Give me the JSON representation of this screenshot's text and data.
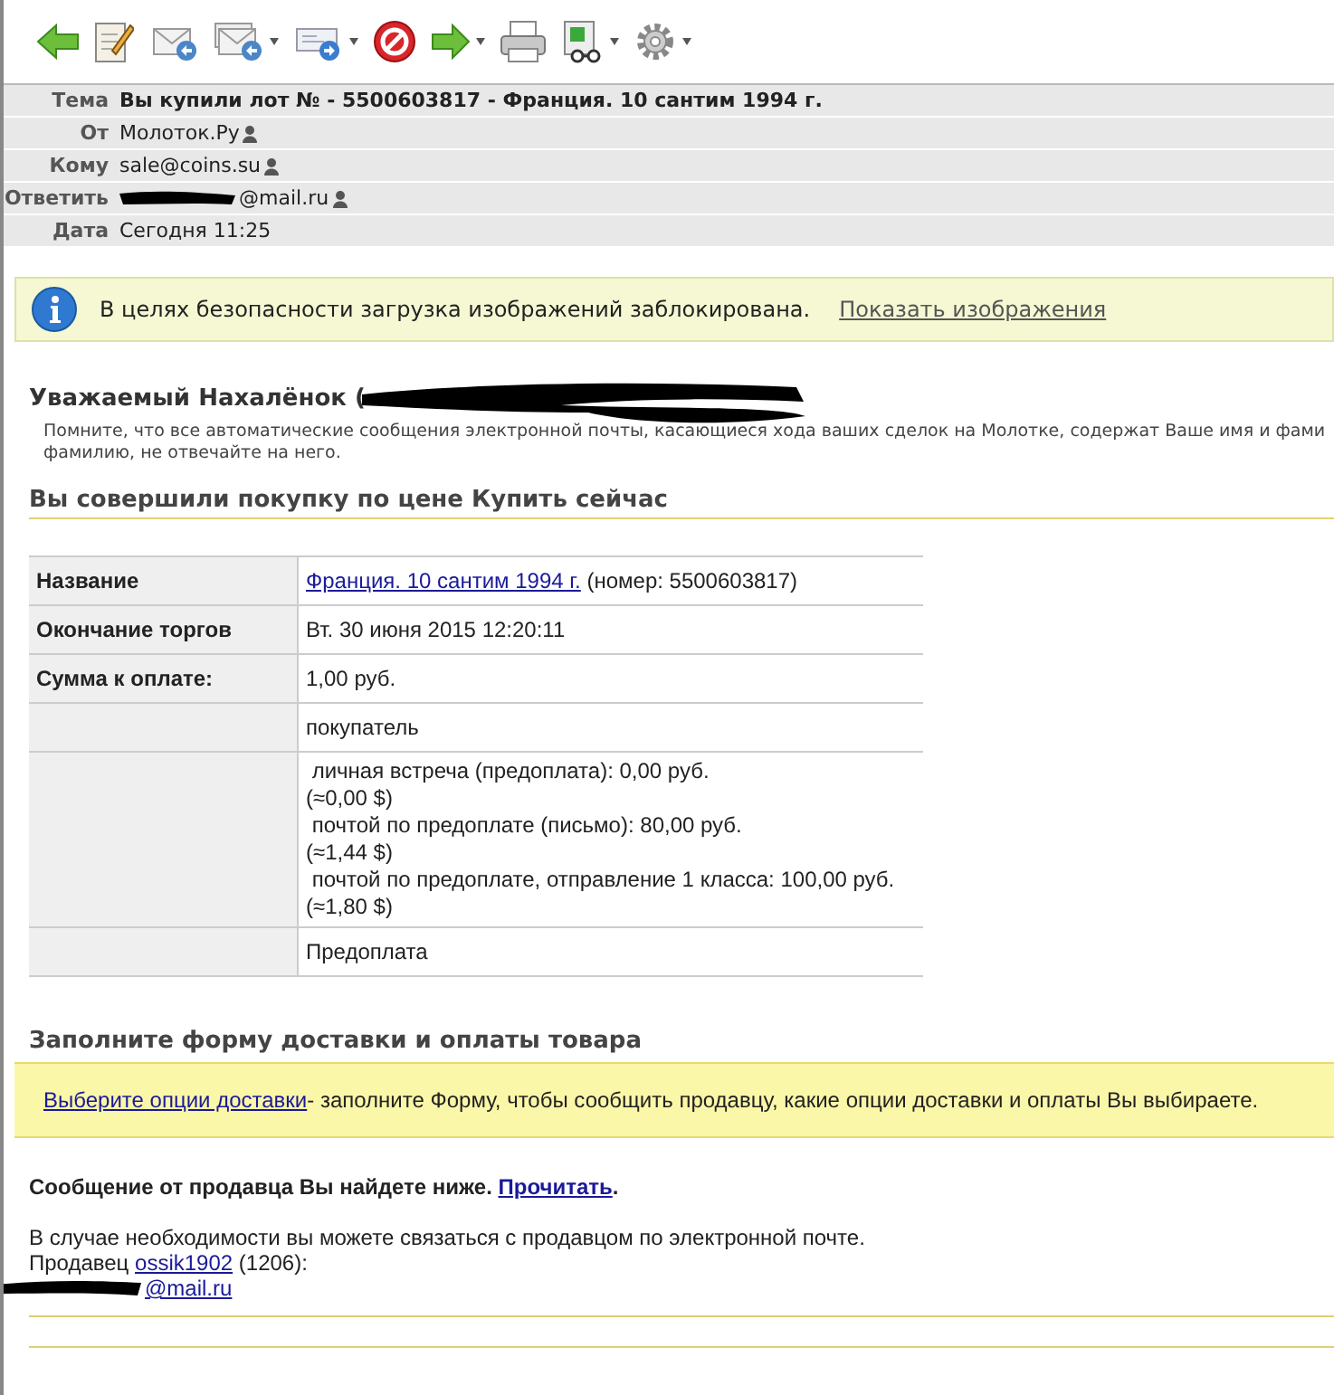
{
  "toolbar": [
    {
      "kind": "back",
      "menu": false
    },
    {
      "kind": "compose",
      "menu": false
    },
    {
      "kind": "reply",
      "menu": false
    },
    {
      "kind": "reply_all",
      "menu": true
    },
    {
      "kind": "forward",
      "menu": true
    },
    {
      "kind": "block",
      "menu": false
    },
    {
      "kind": "next",
      "menu": true
    },
    {
      "kind": "print",
      "menu": false
    },
    {
      "kind": "view",
      "menu": true
    },
    {
      "kind": "settings",
      "menu": true
    }
  ],
  "headers": [
    {
      "label": "Тема",
      "value": "Вы купили лот № - 5500603817 - Франция. 10 сантим 1994 г.",
      "bold": true,
      "contact": false,
      "redacted": false
    },
    {
      "label": "От",
      "value": "Молоток.Ру",
      "bold": false,
      "contact": true,
      "redacted": false
    },
    {
      "label": "Кому",
      "value": "sale@coins.su",
      "bold": false,
      "contact": true,
      "redacted": false
    },
    {
      "label": "Ответить",
      "value": "@mail.ru",
      "bold": false,
      "contact": true,
      "redacted": true
    },
    {
      "label": "Дата",
      "value": "Сегодня 11:25",
      "bold": false,
      "contact": false,
      "redacted": false
    }
  ],
  "security_bar": {
    "message": "В целях безопасности загрузка изображений заблокирована.",
    "link": "Показать изображения"
  },
  "greeting": "Уважаемый Нахалёнок (",
  "notice": [
    "Помните, что все автоматические сообщения электронной почты, касающиеся хода ваших сделок на Молотке, содержат Ваше имя и фами",
    "фамилию, не отвечайте на него."
  ],
  "purchase_heading": "Вы совершили покупку по цене Купить сейчас",
  "table": {
    "rows": [
      {
        "label": "Название",
        "link": "Франция. 10 сантим 1994 г.",
        "lines": [
          " (номер: 5500603817)"
        ]
      },
      {
        "label": "Окончание торгов",
        "lines": [
          "Вт. 30 июня 2015 12:20:11"
        ]
      },
      {
        "label": "Сумма к оплате:",
        "lines": [
          "1,00 руб."
        ]
      },
      {
        "lines": [
          "покупатель"
        ]
      },
      {
        "lines": [
          " личная встреча (предоплата): 0,00 руб.",
          "(≈0,00 $)",
          " почтой по предоплате (письмо): 80,00 руб.",
          "(≈1,44 $)",
          " почтой по предоплате, отправление 1 класса: 100,00 руб.",
          "(≈1,80 $)"
        ]
      },
      {
        "lines": [
          "Предоплата"
        ]
      }
    ]
  },
  "delivery_heading": "Заполните форму доставки и оплаты товара",
  "delivery_bar": {
    "link": "Выберите опции доставки",
    "text": "- заполните Форму, чтобы сообщить продавцу, какие опции доставки и оплаты Вы выбираете."
  },
  "seller_message": {
    "text": "Сообщение от продавца Вы найдете ниже.",
    "link": "Прочитать",
    "end": "."
  },
  "contact_text": "В случае необходимости вы можете связаться с продавцом по электронной почте.",
  "seller": {
    "prefix": "Продавец",
    "link": "ossik1902",
    "suffix": "(1206):"
  },
  "seller_email": "@mail.ru"
}
